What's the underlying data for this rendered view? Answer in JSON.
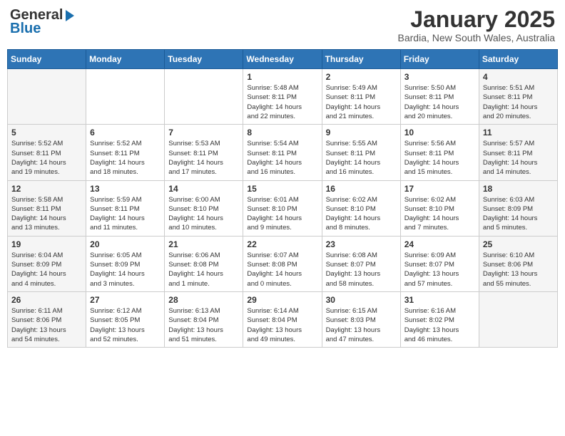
{
  "header": {
    "logo_general": "General",
    "logo_blue": "Blue",
    "title": "January 2025",
    "subtitle": "Bardia, New South Wales, Australia"
  },
  "weekdays": [
    "Sunday",
    "Monday",
    "Tuesday",
    "Wednesday",
    "Thursday",
    "Friday",
    "Saturday"
  ],
  "weeks": [
    [
      {
        "day": "",
        "info": ""
      },
      {
        "day": "",
        "info": ""
      },
      {
        "day": "",
        "info": ""
      },
      {
        "day": "1",
        "info": "Sunrise: 5:48 AM\nSunset: 8:11 PM\nDaylight: 14 hours\nand 22 minutes."
      },
      {
        "day": "2",
        "info": "Sunrise: 5:49 AM\nSunset: 8:11 PM\nDaylight: 14 hours\nand 21 minutes."
      },
      {
        "day": "3",
        "info": "Sunrise: 5:50 AM\nSunset: 8:11 PM\nDaylight: 14 hours\nand 20 minutes."
      },
      {
        "day": "4",
        "info": "Sunrise: 5:51 AM\nSunset: 8:11 PM\nDaylight: 14 hours\nand 20 minutes."
      }
    ],
    [
      {
        "day": "5",
        "info": "Sunrise: 5:52 AM\nSunset: 8:11 PM\nDaylight: 14 hours\nand 19 minutes."
      },
      {
        "day": "6",
        "info": "Sunrise: 5:52 AM\nSunset: 8:11 PM\nDaylight: 14 hours\nand 18 minutes."
      },
      {
        "day": "7",
        "info": "Sunrise: 5:53 AM\nSunset: 8:11 PM\nDaylight: 14 hours\nand 17 minutes."
      },
      {
        "day": "8",
        "info": "Sunrise: 5:54 AM\nSunset: 8:11 PM\nDaylight: 14 hours\nand 16 minutes."
      },
      {
        "day": "9",
        "info": "Sunrise: 5:55 AM\nSunset: 8:11 PM\nDaylight: 14 hours\nand 16 minutes."
      },
      {
        "day": "10",
        "info": "Sunrise: 5:56 AM\nSunset: 8:11 PM\nDaylight: 14 hours\nand 15 minutes."
      },
      {
        "day": "11",
        "info": "Sunrise: 5:57 AM\nSunset: 8:11 PM\nDaylight: 14 hours\nand 14 minutes."
      }
    ],
    [
      {
        "day": "12",
        "info": "Sunrise: 5:58 AM\nSunset: 8:11 PM\nDaylight: 14 hours\nand 13 minutes."
      },
      {
        "day": "13",
        "info": "Sunrise: 5:59 AM\nSunset: 8:11 PM\nDaylight: 14 hours\nand 11 minutes."
      },
      {
        "day": "14",
        "info": "Sunrise: 6:00 AM\nSunset: 8:10 PM\nDaylight: 14 hours\nand 10 minutes."
      },
      {
        "day": "15",
        "info": "Sunrise: 6:01 AM\nSunset: 8:10 PM\nDaylight: 14 hours\nand 9 minutes."
      },
      {
        "day": "16",
        "info": "Sunrise: 6:02 AM\nSunset: 8:10 PM\nDaylight: 14 hours\nand 8 minutes."
      },
      {
        "day": "17",
        "info": "Sunrise: 6:02 AM\nSunset: 8:10 PM\nDaylight: 14 hours\nand 7 minutes."
      },
      {
        "day": "18",
        "info": "Sunrise: 6:03 AM\nSunset: 8:09 PM\nDaylight: 14 hours\nand 5 minutes."
      }
    ],
    [
      {
        "day": "19",
        "info": "Sunrise: 6:04 AM\nSunset: 8:09 PM\nDaylight: 14 hours\nand 4 minutes."
      },
      {
        "day": "20",
        "info": "Sunrise: 6:05 AM\nSunset: 8:09 PM\nDaylight: 14 hours\nand 3 minutes."
      },
      {
        "day": "21",
        "info": "Sunrise: 6:06 AM\nSunset: 8:08 PM\nDaylight: 14 hours\nand 1 minute."
      },
      {
        "day": "22",
        "info": "Sunrise: 6:07 AM\nSunset: 8:08 PM\nDaylight: 14 hours\nand 0 minutes."
      },
      {
        "day": "23",
        "info": "Sunrise: 6:08 AM\nSunset: 8:07 PM\nDaylight: 13 hours\nand 58 minutes."
      },
      {
        "day": "24",
        "info": "Sunrise: 6:09 AM\nSunset: 8:07 PM\nDaylight: 13 hours\nand 57 minutes."
      },
      {
        "day": "25",
        "info": "Sunrise: 6:10 AM\nSunset: 8:06 PM\nDaylight: 13 hours\nand 55 minutes."
      }
    ],
    [
      {
        "day": "26",
        "info": "Sunrise: 6:11 AM\nSunset: 8:06 PM\nDaylight: 13 hours\nand 54 minutes."
      },
      {
        "day": "27",
        "info": "Sunrise: 6:12 AM\nSunset: 8:05 PM\nDaylight: 13 hours\nand 52 minutes."
      },
      {
        "day": "28",
        "info": "Sunrise: 6:13 AM\nSunset: 8:04 PM\nDaylight: 13 hours\nand 51 minutes."
      },
      {
        "day": "29",
        "info": "Sunrise: 6:14 AM\nSunset: 8:04 PM\nDaylight: 13 hours\nand 49 minutes."
      },
      {
        "day": "30",
        "info": "Sunrise: 6:15 AM\nSunset: 8:03 PM\nDaylight: 13 hours\nand 47 minutes."
      },
      {
        "day": "31",
        "info": "Sunrise: 6:16 AM\nSunset: 8:02 PM\nDaylight: 13 hours\nand 46 minutes."
      },
      {
        "day": "",
        "info": ""
      }
    ]
  ]
}
